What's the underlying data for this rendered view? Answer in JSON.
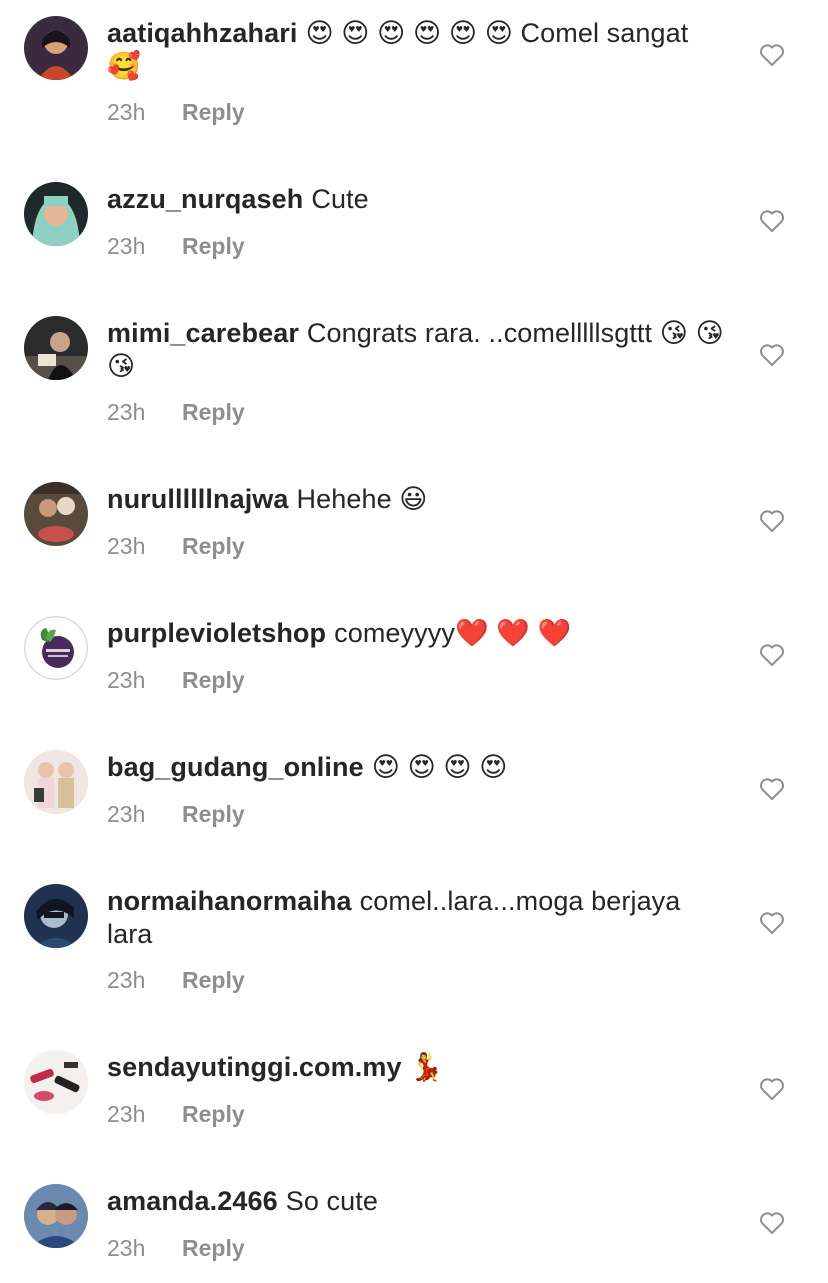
{
  "comments": [
    {
      "username": "aatiqahhzahari",
      "text": "😍 😍 😍 😍 😍 😍  Comel sangat 🥰",
      "time": "23h",
      "reply": "Reply",
      "avatar": "avatar-photo"
    },
    {
      "username": "azzu_nurqaseh",
      "text": "Cute",
      "time": "23h",
      "reply": "Reply",
      "avatar": "avatar-photo"
    },
    {
      "username": "mimi_carebear",
      "text": "Congrats rara. ..comelllllsgttt 😘 😘 😘",
      "time": "23h",
      "reply": "Reply",
      "avatar": "avatar-photo"
    },
    {
      "username": "nurullllllnajwa",
      "text": "Hehehe 😃",
      "time": "23h",
      "reply": "Reply",
      "avatar": "avatar-photo"
    },
    {
      "username": "purplevioletshop",
      "text": "comeyyyy❤️ ❤️ ❤️",
      "time": "23h",
      "reply": "Reply",
      "avatar": "avatar-logo"
    },
    {
      "username": "bag_gudang_online",
      "text": "😍 😍 😍 😍",
      "time": "23h",
      "reply": "Reply",
      "avatar": "avatar-photo"
    },
    {
      "username": "normaihanormaiha",
      "text": "comel..lara...moga berjaya lara",
      "time": "23h",
      "reply": "Reply",
      "avatar": "avatar-photo"
    },
    {
      "username": "sendayutinggi.com.my",
      "text": "💃",
      "time": "23h",
      "reply": "Reply",
      "avatar": "avatar-photo"
    },
    {
      "username": "amanda.2466",
      "text": "So cute",
      "time": "23h",
      "reply": "Reply",
      "avatar": "avatar-photo"
    }
  ],
  "icons": {
    "like": "heart-outline-icon"
  },
  "colors": {
    "text": "#262626",
    "meta": "#8e8e8e",
    "icon": "#8e8e8e"
  }
}
